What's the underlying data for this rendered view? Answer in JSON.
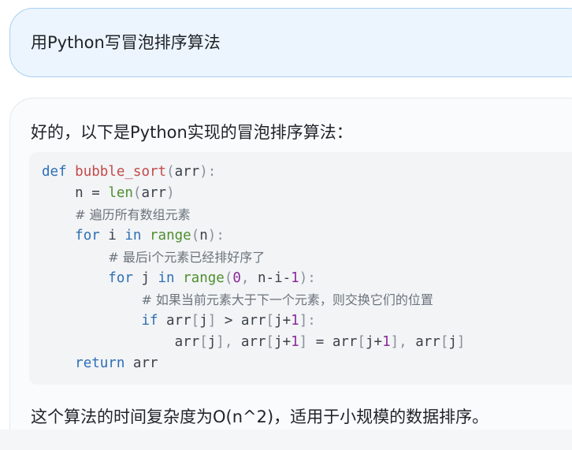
{
  "conversation": {
    "user_message": {
      "text": "用Python写冒泡排序算法"
    },
    "assistant_message": {
      "intro": "好的，以下是Python实现的冒泡排序算法：",
      "code": {
        "language": "python",
        "lines": [
          [
            {
              "t": "kw",
              "v": "def"
            },
            {
              "t": "sp",
              "v": " "
            },
            {
              "t": "fn",
              "v": "bubble_sort"
            },
            {
              "t": "punc",
              "v": "("
            },
            {
              "t": "var",
              "v": "arr"
            },
            {
              "t": "punc",
              "v": "):"
            }
          ],
          [
            {
              "t": "sp",
              "v": "    "
            },
            {
              "t": "var",
              "v": "n"
            },
            {
              "t": "op",
              "v": " = "
            },
            {
              "t": "builtin",
              "v": "len"
            },
            {
              "t": "punc",
              "v": "("
            },
            {
              "t": "var",
              "v": "arr"
            },
            {
              "t": "punc",
              "v": ")"
            }
          ],
          [
            {
              "t": "sp",
              "v": "    "
            },
            {
              "t": "comment",
              "v": "# 遍历所有数组元素"
            }
          ],
          [
            {
              "t": "sp",
              "v": "    "
            },
            {
              "t": "kw",
              "v": "for"
            },
            {
              "t": "var",
              "v": " i "
            },
            {
              "t": "kw",
              "v": "in"
            },
            {
              "t": "sp",
              "v": " "
            },
            {
              "t": "builtin",
              "v": "range"
            },
            {
              "t": "punc",
              "v": "("
            },
            {
              "t": "var",
              "v": "n"
            },
            {
              "t": "punc",
              "v": "):"
            }
          ],
          [
            {
              "t": "sp",
              "v": "        "
            },
            {
              "t": "comment",
              "v": "# 最后i个元素已经排好序了"
            }
          ],
          [
            {
              "t": "sp",
              "v": "        "
            },
            {
              "t": "kw",
              "v": "for"
            },
            {
              "t": "var",
              "v": " j "
            },
            {
              "t": "kw",
              "v": "in"
            },
            {
              "t": "sp",
              "v": " "
            },
            {
              "t": "builtin",
              "v": "range"
            },
            {
              "t": "punc",
              "v": "("
            },
            {
              "t": "num",
              "v": "0"
            },
            {
              "t": "punc",
              "v": ", "
            },
            {
              "t": "var",
              "v": "n-i-"
            },
            {
              "t": "num",
              "v": "1"
            },
            {
              "t": "punc",
              "v": "):"
            }
          ],
          [
            {
              "t": "sp",
              "v": "            "
            },
            {
              "t": "comment",
              "v": "# 如果当前元素大于下一个元素，则交换它们的位置"
            }
          ],
          [
            {
              "t": "sp",
              "v": "            "
            },
            {
              "t": "kw",
              "v": "if"
            },
            {
              "t": "var",
              "v": " arr"
            },
            {
              "t": "punc",
              "v": "["
            },
            {
              "t": "var",
              "v": "j"
            },
            {
              "t": "punc",
              "v": "]"
            },
            {
              "t": "op",
              "v": " > "
            },
            {
              "t": "var",
              "v": "arr"
            },
            {
              "t": "punc",
              "v": "["
            },
            {
              "t": "var",
              "v": "j+"
            },
            {
              "t": "num",
              "v": "1"
            },
            {
              "t": "punc",
              "v": "]:"
            }
          ],
          [
            {
              "t": "sp",
              "v": "                "
            },
            {
              "t": "var",
              "v": "arr"
            },
            {
              "t": "punc",
              "v": "["
            },
            {
              "t": "var",
              "v": "j"
            },
            {
              "t": "punc",
              "v": "], "
            },
            {
              "t": "var",
              "v": "arr"
            },
            {
              "t": "punc",
              "v": "["
            },
            {
              "t": "var",
              "v": "j+"
            },
            {
              "t": "num",
              "v": "1"
            },
            {
              "t": "punc",
              "v": "]"
            },
            {
              "t": "op",
              "v": " = "
            },
            {
              "t": "var",
              "v": "arr"
            },
            {
              "t": "punc",
              "v": "["
            },
            {
              "t": "var",
              "v": "j+"
            },
            {
              "t": "num",
              "v": "1"
            },
            {
              "t": "punc",
              "v": "], "
            },
            {
              "t": "var",
              "v": "arr"
            },
            {
              "t": "punc",
              "v": "["
            },
            {
              "t": "var",
              "v": "j"
            },
            {
              "t": "punc",
              "v": "]"
            }
          ],
          [
            {
              "t": "sp",
              "v": "    "
            },
            {
              "t": "kw",
              "v": "return"
            },
            {
              "t": "var",
              "v": " arr"
            }
          ]
        ]
      },
      "summary": "这个算法的时间复杂度为O(n^2)，适用于小规模的数据排序。"
    }
  },
  "colors": {
    "user_bubble_bg": "#ecf5fd",
    "user_bubble_border": "#a9d0f0",
    "code_bg": "#f2f4f6",
    "keyword": "#2f6fb3",
    "function_name": "#c34a4a",
    "builtin": "#4f8f2f",
    "number": "#8a2a9a",
    "comment": "#6c737c"
  }
}
